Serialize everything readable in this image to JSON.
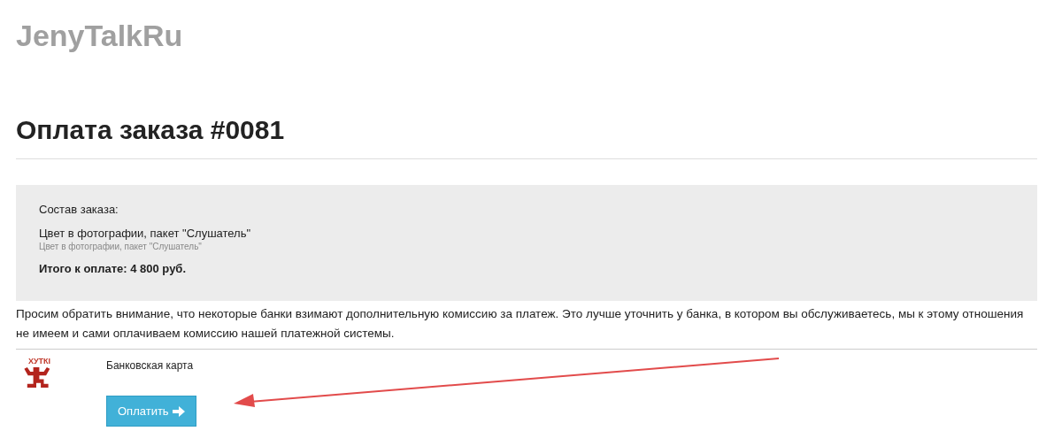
{
  "site_title": "JenyTalkRu",
  "heading": "Оплата заказа #0081",
  "order": {
    "label": "Состав заказа:",
    "item": "Цвет в фотографии, пакет \"Слушатель\"",
    "item_note": "Цвет в фотографии, пакет \"Слушатель\"",
    "total": "Итого к оплате: 4 800 руб."
  },
  "notice": "Просим обратить внимание, что некоторые банки взимают дополнительную комиссию за платеж. Это лучше уточнить у банка, в котором вы обслуживаетесь, мы к этому отношения не имеем и сами оплачиваем комиссию нашей платежной системы.",
  "payment": {
    "logo_text": "ХУТКІ",
    "method": "Банковская карта",
    "button": "Оплатить"
  }
}
